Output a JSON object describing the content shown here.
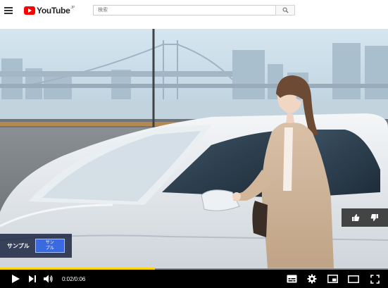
{
  "header": {
    "logo_text": "YouTube",
    "logo_region": "JP",
    "search_placeholder": "検索"
  },
  "video": {
    "ad_label": "サンプル",
    "ad_button": "サン\nプル",
    "progress_fraction": 0.4,
    "time_display": "0:02/0:06"
  },
  "colors": {
    "brand_red": "#ff0000",
    "progress": "#ffd400",
    "ad_button": "#3b6ae0"
  },
  "icons": {
    "menu": "menu-icon",
    "search": "search-icon",
    "play": "play-icon",
    "next": "skip-next-icon",
    "volume": "volume-icon",
    "subtitles": "subtitles-icon",
    "settings": "gear-icon",
    "miniplayer": "miniplayer-icon",
    "theater": "theater-icon",
    "fullscreen": "fullscreen-icon",
    "like": "thumbs-up-icon",
    "dislike": "thumbs-down-icon"
  }
}
